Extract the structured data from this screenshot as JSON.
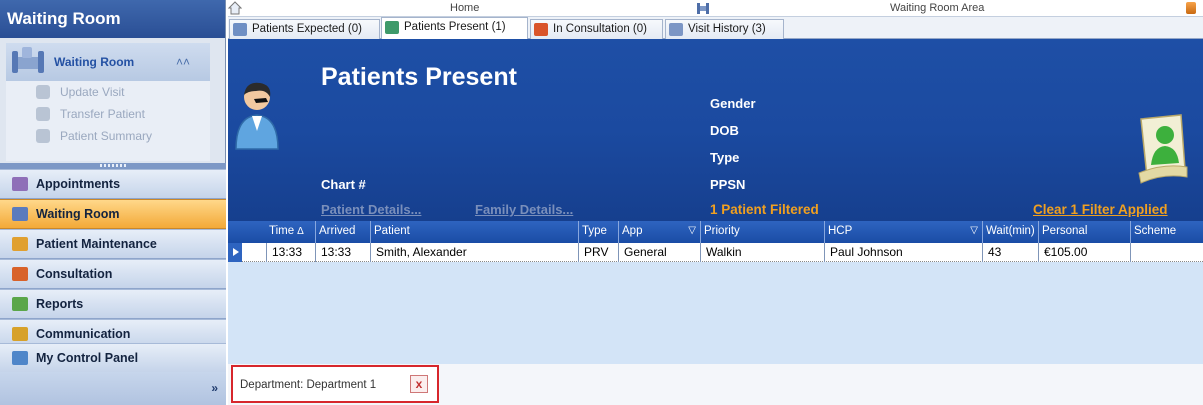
{
  "sidebar": {
    "title": "Waiting Room",
    "panel": {
      "header": "Waiting Room",
      "items": [
        "Update Visit",
        "Transfer Patient",
        "Patient Summary"
      ]
    },
    "nav": [
      {
        "label": "Appointments",
        "icon": "appointments-icon",
        "active": false
      },
      {
        "label": "Waiting Room",
        "icon": "waiting-room-icon",
        "active": true
      },
      {
        "label": "Patient Maintenance",
        "icon": "patient-maintenance-icon",
        "active": false
      },
      {
        "label": "Consultation",
        "icon": "consultation-icon",
        "active": false
      },
      {
        "label": "Reports",
        "icon": "reports-icon",
        "active": false
      },
      {
        "label": "Communication",
        "icon": "communication-icon",
        "active": false
      },
      {
        "label": "My Control Panel",
        "icon": "control-panel-icon",
        "active": false
      }
    ],
    "more": "»"
  },
  "topbar": {
    "home_label": "Home",
    "area_label": "Waiting Room Area"
  },
  "tabs": [
    {
      "label": "Patients Expected (0)"
    },
    {
      "label": "Patients Present (1)"
    },
    {
      "label": "In Consultation (0)"
    },
    {
      "label": "Visit History (3)"
    }
  ],
  "header": {
    "title": "Patients Present",
    "gender_label": "Gender",
    "dob_label": "DOB",
    "type_label": "Type",
    "ppsn_label": "PPSN",
    "chart_label": "Chart #",
    "patient_details_link": "Patient Details...",
    "family_details_link": "Family Details...",
    "filtered_text": "1 Patient Filtered",
    "clear_filter_link": "Clear 1 Filter Applied"
  },
  "grid": {
    "columns": [
      "Time",
      "Arrived",
      "Patient",
      "Type",
      "App",
      "Priority",
      "HCP",
      "Wait(min)",
      "Personal",
      "Scheme"
    ],
    "rows": [
      [
        "13:33",
        "13:33",
        "Smith, Alexander",
        "PRV",
        "General",
        "Walkin",
        "Paul Johnson",
        "43",
        "€105.00",
        ""
      ]
    ]
  },
  "filter": {
    "text": "Department: Department 1",
    "close": "x"
  },
  "colors": {
    "header_blue": "#1e4fa6",
    "active_nav": "#f3a938",
    "filter_orange": "#f0a020",
    "filter_border": "#d7262c"
  }
}
